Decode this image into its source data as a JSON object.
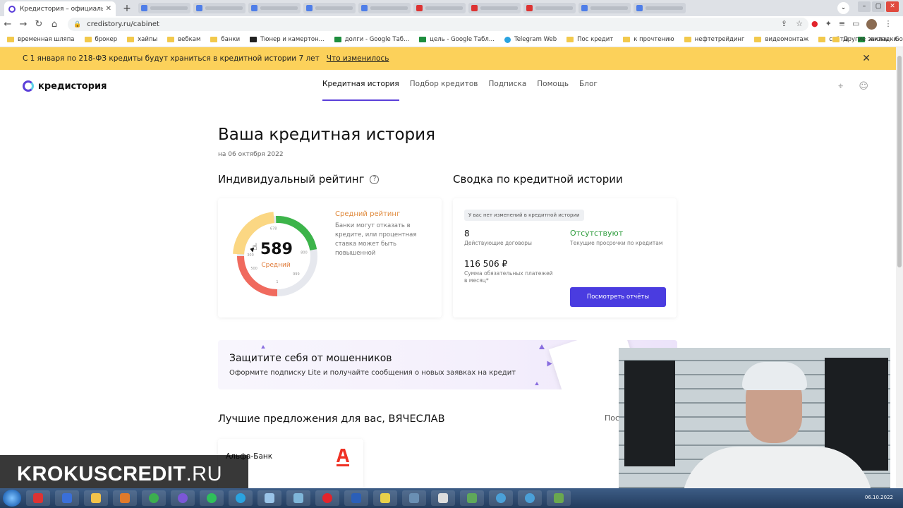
{
  "browser": {
    "tab_title": "Кредистория – официальный с",
    "url": "credistory.ru/cabinet",
    "bookmarks": [
      {
        "label": "временная шляпа",
        "icon": "folder-icon"
      },
      {
        "label": "брокер",
        "icon": "folder-icon"
      },
      {
        "label": "хайпы",
        "icon": "folder-icon"
      },
      {
        "label": "вебкам",
        "icon": "folder-icon"
      },
      {
        "label": "банки",
        "icon": "folder-icon"
      },
      {
        "label": "Тюнер и камертон...",
        "icon": "tuner-icon"
      },
      {
        "label": "долги - Google Таб...",
        "icon": "sheets-icon"
      },
      {
        "label": "цель - Google Табл...",
        "icon": "sheets-icon"
      },
      {
        "label": "Telegram Web",
        "icon": "telegram-icon"
      },
      {
        "label": "Пос кредит",
        "icon": "folder-icon"
      },
      {
        "label": "к прочтению",
        "icon": "folder-icon"
      },
      {
        "label": "нефтетрейдинг",
        "icon": "folder-icon"
      },
      {
        "label": "видеомонтаж",
        "icon": "folder-icon"
      },
      {
        "label": "сайты",
        "icon": "folder-icon"
      },
      {
        "label": "жизнь - Google Та...",
        "icon": "sheets-icon"
      }
    ],
    "other_bookmarks": "Другие закладки"
  },
  "banner": {
    "text": "С 1 января по 218-ФЗ кредиты будут храниться в кредитной истории 7 лет",
    "link": "Что изменилось"
  },
  "site": {
    "logo": "кредистория",
    "nav": [
      "Кредитная история",
      "Подбор кредитов",
      "Подписка",
      "Помощь",
      "Блог"
    ]
  },
  "main": {
    "title": "Ваша кредитная история",
    "date": "на 06 октября 2022",
    "rating": {
      "heading": "Индивидуальный рейтинг",
      "score": "589",
      "score_level": "Средний",
      "score_fraction": 0.589,
      "ticks": [
        "300",
        "678",
        "800",
        "999",
        "1",
        "500"
      ],
      "status_title": "Средний рейтинг",
      "status_desc": "Банки могут отказать в кредите, или процентная ставка может быть повышенной"
    },
    "summary": {
      "heading": "Сводка по кредитной истории",
      "chip": "У вас нет изменений в кредитной истории",
      "contracts_value": "8",
      "contracts_label": "Действующие договоры",
      "overdue_value": "Отсутствуют",
      "overdue_label": "Текущие просрочки по кредитам",
      "payments_value": "116 506 ₽",
      "payments_label": "Сумма обязательных платежей в месяц*",
      "button": "Посмотреть отчёты"
    },
    "promo": {
      "title": "Защитите себя от мошенников",
      "subtitle": "Оформите подписку Lite и получайте сообщения о новых заявках на кредит"
    },
    "offers": {
      "heading": "Лучшие предложения для вас, ВЯЧЕСЛАВ",
      "more": "Пос",
      "bank": "Альфа-Банк"
    }
  },
  "watermark": {
    "bold": "KROKUSCREDIT",
    "light": ".RU"
  },
  "taskbar": {
    "clock": "06.10.2022"
  },
  "colors": {
    "accent": "#5b3fd9",
    "banner": "#fcd15a",
    "good": "#2d9c3c",
    "mid": "#e08a3c"
  }
}
